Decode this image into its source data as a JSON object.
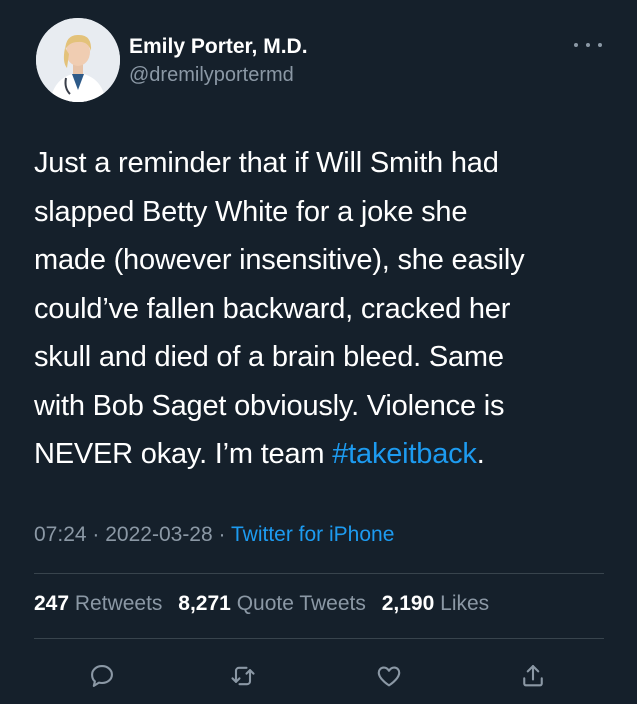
{
  "author": {
    "display_name": "Emily Porter, M.D.",
    "handle": "@dremilyportermd"
  },
  "tweet": {
    "text_parts": [
      "Just a reminder that if Will Smith had",
      "slapped Betty White for a joke she",
      "made (however insensitive), she easily",
      "could’ve fallen backward, cracked her",
      "skull and died of a brain bleed. Same",
      "with Bob Saget obviously. Violence is",
      "NEVER okay. I’m team "
    ],
    "hashtag": "#takeitback",
    "trailing": ".",
    "time": "07:24",
    "date": "2022-03-28",
    "separator": "·",
    "source": "Twitter for iPhone"
  },
  "stats": {
    "retweets_count": "247",
    "retweets_label": "Retweets",
    "quotes_count": "8,271",
    "quotes_label": "Quote Tweets",
    "likes_count": "2,190",
    "likes_label": "Likes"
  },
  "icons": {
    "reply": "reply-icon",
    "retweet": "retweet-icon",
    "like": "like-icon",
    "share": "share-icon",
    "more": "more-icon"
  },
  "colors": {
    "background": "#15202b",
    "text": "#ffffff",
    "secondary": "#8b98a5",
    "accent": "#1d9bf0",
    "divider": "#38444d"
  }
}
